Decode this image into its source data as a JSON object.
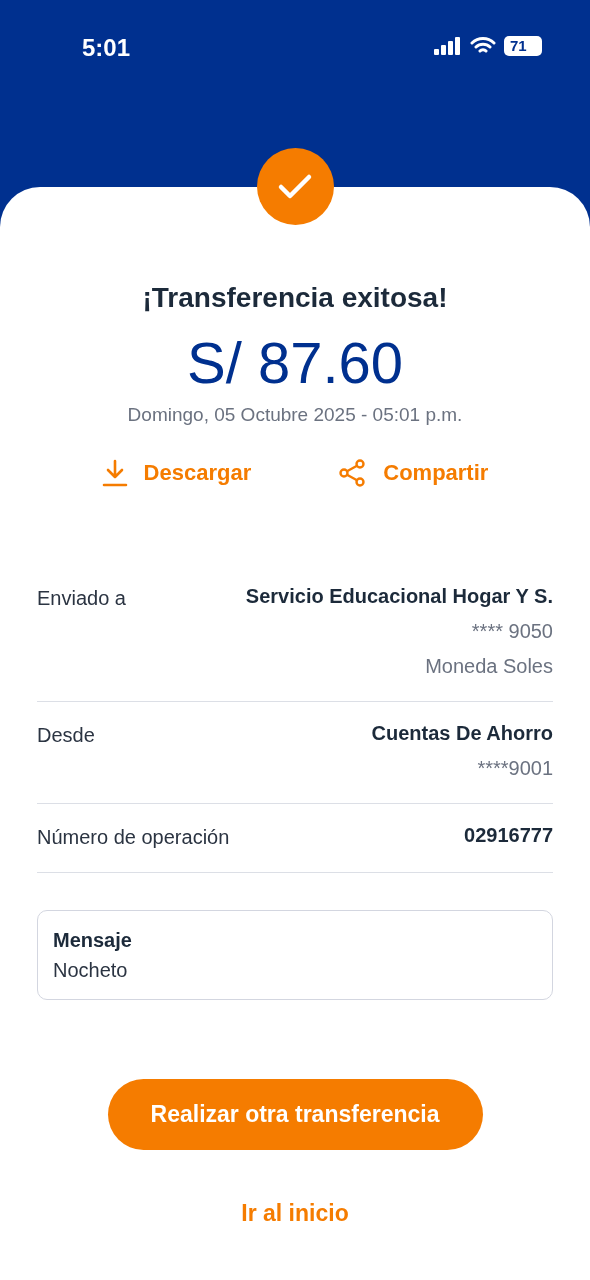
{
  "status_bar": {
    "time": "5:01",
    "battery": "71"
  },
  "title": "¡Transferencia exitosa!",
  "amount": "S/ 87.60",
  "date": "Domingo, 05 Octubre 2025 - 05:01 p.m.",
  "actions": [
    {
      "kind": "download",
      "label": "Descargar"
    },
    {
      "kind": "share",
      "label": "Compartir"
    }
  ],
  "details": [
    {
      "label": "Enviado a",
      "values": [
        {
          "text": "Servicio Educacional Hogar Y S.",
          "bold": true
        },
        {
          "text": "**** 9050",
          "bold": false
        },
        {
          "text": "Moneda Soles",
          "bold": false
        }
      ]
    },
    {
      "label": "Desde",
      "values": [
        {
          "text": "Cuentas De Ahorro",
          "bold": true
        },
        {
          "text": "****9001",
          "bold": false
        }
      ]
    },
    {
      "label": "Número de operación",
      "values": [
        {
          "text": "02916777",
          "bold": true
        }
      ]
    }
  ],
  "message": {
    "label": "Mensaje",
    "text": "Nocheto"
  },
  "primary_button": "Realizar otra transferencia",
  "link": "Ir al inicio"
}
